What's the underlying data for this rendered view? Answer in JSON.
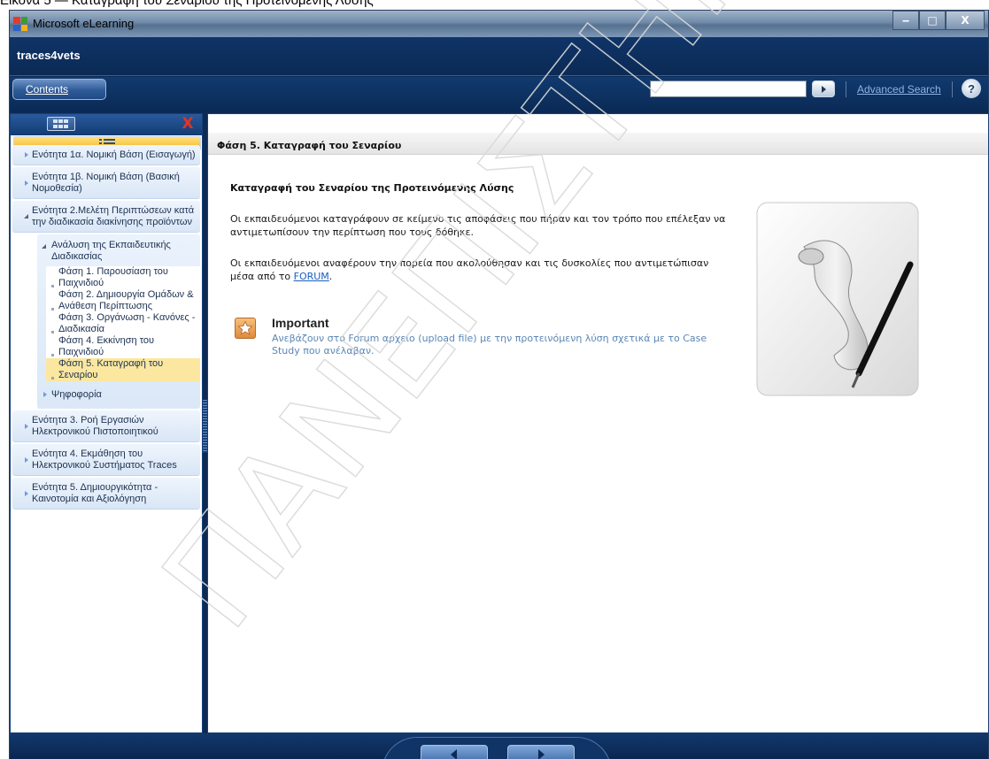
{
  "document_caption": "Εικόνα 5 — Καταγραφή του Σεναρίου της Προτεινόμενης Λύσης",
  "window": {
    "title": "Microsoft eLearning",
    "minimize_glyph": "‒",
    "maximize_glyph": "□",
    "close_glyph": "X"
  },
  "brand": "traces4vets",
  "toolbar": {
    "contents_label": "Contents",
    "search_value": "",
    "advanced_search_label": "Advanced Search",
    "help_glyph": "?"
  },
  "sidebar": {
    "close_glyph": "X",
    "items": [
      {
        "label": "Ενότητα 1α. Νομική Βάση (Εισαγωγή)"
      },
      {
        "label": "Ενότητα 1β. Νομική Βάση (Βασική Νομοθεσία)"
      },
      {
        "label": "Ενότητα 2.Μελέτη Περιπτώσεων κατά την διαδικασία διακίνησης προϊόντων"
      },
      {
        "label": "Ενότητα 3. Ροή Εργασιών Ηλεκτρονικού Πιστοποιητικού"
      },
      {
        "label": "Ενότητα 4. Εκμάθηση του Ηλεκτρονικού Συστήματος Traces"
      },
      {
        "label": "Ενότητα 5. Δημιουργικότητα - Καινοτομία και Αξιολόγηση"
      }
    ],
    "sub_open": "Ανάλυση της Εκπαιδευτικής Διαδικασίας",
    "leaves": [
      "Φάση 1. Παρουσίαση του Παιχνιδιού",
      "Φάση 2. Δημιουργία Ομάδων & Ανάθεση Περίπτωσης",
      "Φάση 3. Οργάνωση - Κανόνες - Διαδικασία",
      "Φάση 4. Εκκίνηση του Παιχνιδιού",
      "Φάση 5. Καταγραφή του Σεναρίου"
    ],
    "sub_closed": "Ψηφοφορία"
  },
  "content": {
    "page_title": "Φάση 5. Καταγραφή του Σεναρίου",
    "section_title": "Καταγραφή του Σεναρίου της Προτεινόμενης Λύσης",
    "para1": "Οι εκπαιδευόμενοι καταγράφουν σε κείμενο τις αποφάσεις που πήραν και τον τρόπο που επέλεξαν να αντιμετωπίσουν την περίπτωση που τους δόθηκε.",
    "para2_text": "Οι εκπαιδευόμενοι αναφέρουν την πορεία που ακολούθησαν και τις δυσκολίες που αντιμετώπισαν μέσα από το ",
    "para2_link": "FORUM",
    "para2_end": ".",
    "important_title": "Important",
    "important_text": "Ανεβάζουν στο Forum αρχείο (upload file) με την προτεινόμενη λύση σχετικά με το Case Study που ανέλαβαν."
  },
  "watermark_text": "ΠΑΝΕΠΙΣΤΗΜΙΟ ΠΕΙΡΑΙΩΣ",
  "colors": {
    "frame": "#0d2a55",
    "link": "#1a5fc0",
    "important_text": "#5b87b5",
    "active_leaf": "#fbe7a0"
  }
}
